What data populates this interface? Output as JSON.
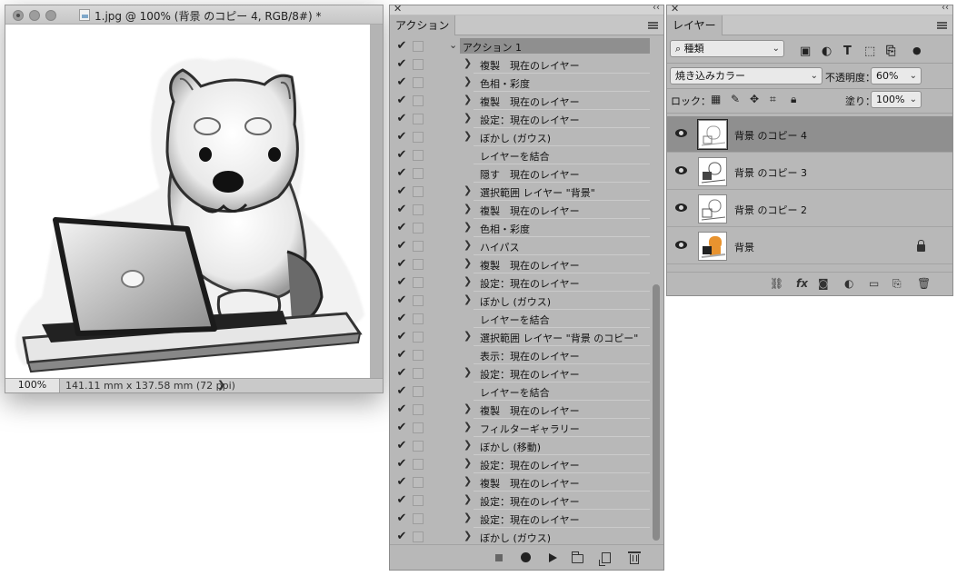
{
  "document": {
    "title": "1.jpg @ 100% (背景 のコピー 4, RGB/8#) *",
    "zoom": "100%",
    "dimensions": "141.11 mm x 137.58 mm (72 ppi)",
    "arrow": "❯"
  },
  "actions_panel": {
    "close": "✕",
    "collapse": "‹‹",
    "tab": "アクション",
    "set_name": "アクション 1",
    "items": [
      {
        "label": "複製　現在のレイヤー",
        "expand": "❯"
      },
      {
        "label": "色相・彩度",
        "expand": "❯"
      },
      {
        "label": "複製　現在のレイヤー",
        "expand": "❯"
      },
      {
        "label": "設定：現在のレイヤー",
        "expand": "❯"
      },
      {
        "label": "ぼかし (ガウス)",
        "expand": "❯"
      },
      {
        "label": "レイヤーを結合",
        "expand": ""
      },
      {
        "label": "隠す　現在のレイヤー",
        "expand": ""
      },
      {
        "label": "選択範囲 レイヤー \"背景\"",
        "expand": "❯"
      },
      {
        "label": "複製　現在のレイヤー",
        "expand": "❯"
      },
      {
        "label": "色相・彩度",
        "expand": "❯"
      },
      {
        "label": "ハイパス",
        "expand": "❯"
      },
      {
        "label": "複製　現在のレイヤー",
        "expand": "❯"
      },
      {
        "label": "設定：現在のレイヤー",
        "expand": "❯"
      },
      {
        "label": "ぼかし (ガウス)",
        "expand": "❯"
      },
      {
        "label": "レイヤーを結合",
        "expand": ""
      },
      {
        "label": "選択範囲 レイヤー \"背景 のコピー\"",
        "expand": "❯"
      },
      {
        "label": "表示：現在のレイヤー",
        "expand": ""
      },
      {
        "label": "設定：現在のレイヤー",
        "expand": "❯"
      },
      {
        "label": "レイヤーを結合",
        "expand": ""
      },
      {
        "label": "複製　現在のレイヤー",
        "expand": "❯"
      },
      {
        "label": "フィルターギャラリー",
        "expand": "❯"
      },
      {
        "label": "ぼかし (移動)",
        "expand": "❯"
      },
      {
        "label": "設定：現在のレイヤー",
        "expand": "❯"
      },
      {
        "label": "複製　現在のレイヤー",
        "expand": "❯"
      },
      {
        "label": "設定：現在のレイヤー",
        "expand": "❯"
      },
      {
        "label": "設定：現在のレイヤー",
        "expand": "❯"
      },
      {
        "label": "ぼかし (ガウス)",
        "expand": "❯"
      }
    ],
    "check_glyph": "✔"
  },
  "layers_panel": {
    "close": "✕",
    "collapse": "‹‹",
    "tab": "レイヤー",
    "filter_kind": "種類",
    "blend_mode": "焼き込みカラー",
    "opacity_label": "不透明度：",
    "opacity_value": "60%",
    "lock_label": "ロック：",
    "fill_label": "塗り：",
    "fill_value": "100%",
    "layers": [
      {
        "name": "背景 のコピー 4",
        "selected": true
      },
      {
        "name": "背景 のコピー 3",
        "selected": false
      },
      {
        "name": "背景 のコピー 2",
        "selected": false
      },
      {
        "name": "背景",
        "selected": false,
        "locked": true
      }
    ],
    "footer_fx": "fx"
  },
  "colors": {
    "panel_bg": "#b8b8b8",
    "selected_row": "#8f8f8f",
    "action_set_highlight": "#8f8f8f"
  }
}
